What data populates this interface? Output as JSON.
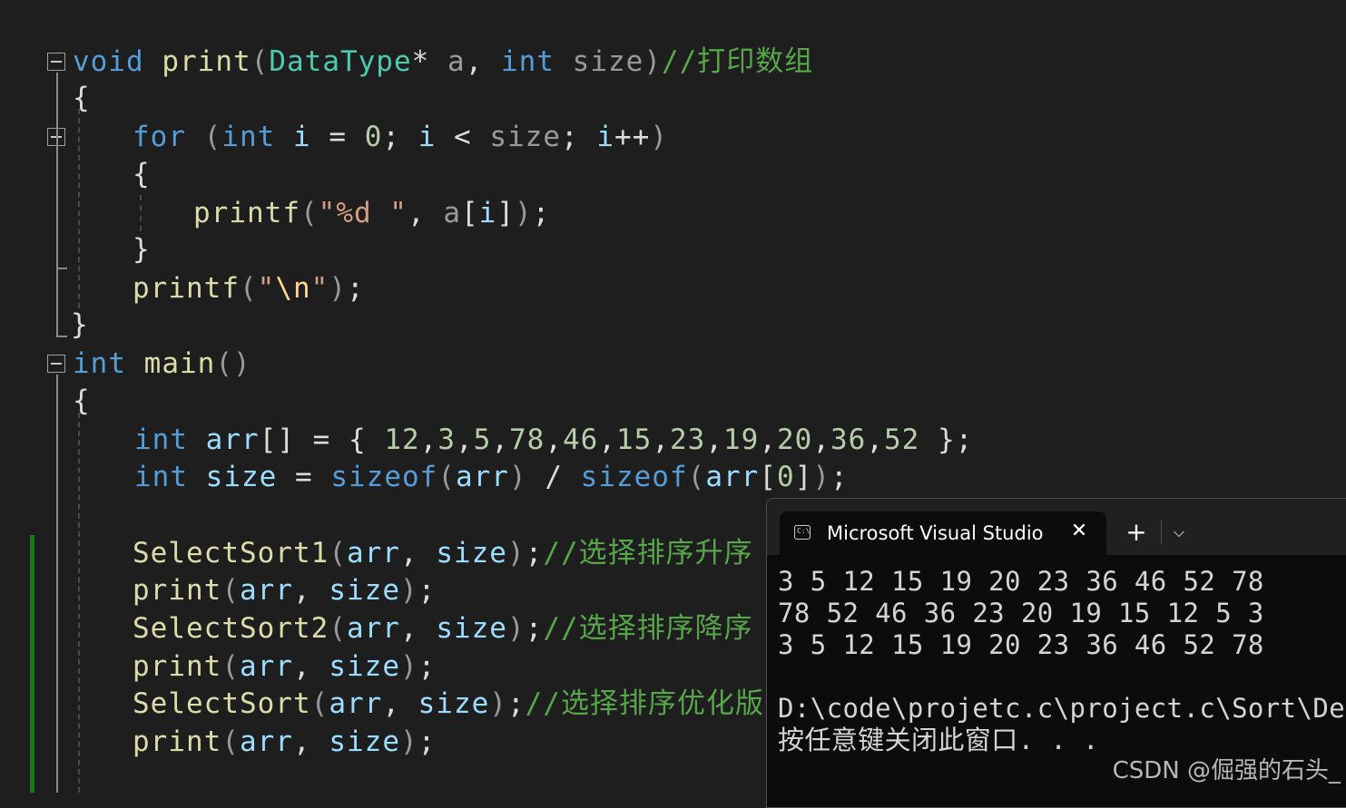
{
  "editor": {
    "lines": [
      {
        "tokens": [
          [
            "kw",
            "void"
          ],
          [
            "pl",
            " "
          ],
          [
            "fn",
            "print"
          ],
          [
            "pm",
            "("
          ],
          [
            "ty",
            "DataType"
          ],
          [
            "pl",
            "*"
          ],
          [
            "pl",
            " "
          ],
          [
            "pm",
            "a"
          ],
          [
            "pl",
            ", "
          ],
          [
            "kw",
            "int"
          ],
          [
            "pl",
            " "
          ],
          [
            "pm",
            "size"
          ],
          [
            "pm",
            ")"
          ],
          [
            "cm",
            "//打印数组"
          ]
        ]
      },
      {
        "tokens": [
          [
            "pl",
            "{"
          ]
        ]
      },
      {
        "tokens": [
          [
            "kw",
            "for"
          ],
          [
            "pl",
            " "
          ],
          [
            "pm",
            "("
          ],
          [
            "kw",
            "int"
          ],
          [
            "pl",
            " "
          ],
          [
            "vr",
            "i"
          ],
          [
            "pl",
            " = "
          ],
          [
            "nm",
            "0"
          ],
          [
            "pl",
            "; "
          ],
          [
            "vr",
            "i"
          ],
          [
            "pl",
            " < "
          ],
          [
            "pm",
            "size"
          ],
          [
            "pl",
            "; "
          ],
          [
            "vr",
            "i"
          ],
          [
            "pl",
            "++"
          ],
          [
            "pm",
            ")"
          ]
        ]
      },
      {
        "tokens": [
          [
            "pl",
            "{"
          ]
        ]
      },
      {
        "tokens": [
          [
            "fn",
            "printf"
          ],
          [
            "pm",
            "("
          ],
          [
            "st",
            "\"%d \""
          ],
          [
            "pl",
            ", "
          ],
          [
            "pm",
            "a"
          ],
          [
            "pl",
            "["
          ],
          [
            "vr",
            "i"
          ],
          [
            "pl",
            "]"
          ],
          [
            "pm",
            ")"
          ],
          [
            "pl",
            ";"
          ]
        ]
      },
      {
        "tokens": [
          [
            "pl",
            "}"
          ]
        ]
      },
      {
        "tokens": [
          [
            "fn",
            "printf"
          ],
          [
            "pm",
            "("
          ],
          [
            "st",
            "\""
          ],
          [
            "es",
            "\\n"
          ],
          [
            "st",
            "\""
          ],
          [
            "pm",
            ")"
          ],
          [
            "pl",
            ";"
          ]
        ]
      },
      {
        "tokens": [
          [
            "pl",
            "}"
          ]
        ]
      },
      {
        "tokens": [
          [
            "kw",
            "int"
          ],
          [
            "pl",
            " "
          ],
          [
            "fn",
            "main"
          ],
          [
            "pm",
            "()"
          ]
        ]
      },
      {
        "tokens": [
          [
            "pl",
            "{"
          ]
        ]
      },
      {
        "tokens": [
          [
            "kw",
            "int"
          ],
          [
            "pl",
            " "
          ],
          [
            "vr",
            "arr"
          ],
          [
            "pl",
            "[] = { "
          ],
          [
            "nm",
            "12"
          ],
          [
            "pl",
            ","
          ],
          [
            "nm",
            "3"
          ],
          [
            "pl",
            ","
          ],
          [
            "nm",
            "5"
          ],
          [
            "pl",
            ","
          ],
          [
            "nm",
            "78"
          ],
          [
            "pl",
            ","
          ],
          [
            "nm",
            "46"
          ],
          [
            "pl",
            ","
          ],
          [
            "nm",
            "15"
          ],
          [
            "pl",
            ","
          ],
          [
            "nm",
            "23"
          ],
          [
            "pl",
            ","
          ],
          [
            "nm",
            "19"
          ],
          [
            "pl",
            ","
          ],
          [
            "nm",
            "20"
          ],
          [
            "pl",
            ","
          ],
          [
            "nm",
            "36"
          ],
          [
            "pl",
            ","
          ],
          [
            "nm",
            "52"
          ],
          [
            "pl",
            " };"
          ]
        ]
      },
      {
        "tokens": [
          [
            "kw",
            "int"
          ],
          [
            "pl",
            " "
          ],
          [
            "vr",
            "size"
          ],
          [
            "pl",
            " = "
          ],
          [
            "kw",
            "sizeof"
          ],
          [
            "pm",
            "("
          ],
          [
            "vr",
            "arr"
          ],
          [
            "pm",
            ")"
          ],
          [
            "pl",
            " / "
          ],
          [
            "kw",
            "sizeof"
          ],
          [
            "pm",
            "("
          ],
          [
            "vr",
            "arr"
          ],
          [
            "pl",
            "["
          ],
          [
            "nm",
            "0"
          ],
          [
            "pl",
            "]"
          ],
          [
            "pm",
            ")"
          ],
          [
            "pl",
            ";"
          ]
        ]
      },
      {
        "tokens": [
          [
            "fn",
            "SelectSort1"
          ],
          [
            "pm",
            "("
          ],
          [
            "vr",
            "arr"
          ],
          [
            "pl",
            ", "
          ],
          [
            "vr",
            "size"
          ],
          [
            "pm",
            ")"
          ],
          [
            "pl",
            ";"
          ],
          [
            "cm",
            "//选择排序升序"
          ]
        ]
      },
      {
        "tokens": [
          [
            "fn",
            "print"
          ],
          [
            "pm",
            "("
          ],
          [
            "vr",
            "arr"
          ],
          [
            "pl",
            ", "
          ],
          [
            "vr",
            "size"
          ],
          [
            "pm",
            ")"
          ],
          [
            "pl",
            ";"
          ]
        ]
      },
      {
        "tokens": [
          [
            "fn",
            "SelectSort2"
          ],
          [
            "pm",
            "("
          ],
          [
            "vr",
            "arr"
          ],
          [
            "pl",
            ", "
          ],
          [
            "vr",
            "size"
          ],
          [
            "pm",
            ")"
          ],
          [
            "pl",
            ";"
          ],
          [
            "cm",
            "//选择排序降序"
          ]
        ]
      },
      {
        "tokens": [
          [
            "fn",
            "print"
          ],
          [
            "pm",
            "("
          ],
          [
            "vr",
            "arr"
          ],
          [
            "pl",
            ", "
          ],
          [
            "vr",
            "size"
          ],
          [
            "pm",
            ")"
          ],
          [
            "pl",
            ";"
          ]
        ]
      },
      {
        "tokens": [
          [
            "fn",
            "SelectSort"
          ],
          [
            "pm",
            "("
          ],
          [
            "vr",
            "arr"
          ],
          [
            "pl",
            ", "
          ],
          [
            "vr",
            "size"
          ],
          [
            "pm",
            ")"
          ],
          [
            "pl",
            ";"
          ],
          [
            "cm",
            "//选择排序优化版"
          ]
        ]
      },
      {
        "tokens": [
          [
            "fn",
            "print"
          ],
          [
            "pm",
            "("
          ],
          [
            "vr",
            "arr"
          ],
          [
            "pl",
            ", "
          ],
          [
            "vr",
            "size"
          ],
          [
            "pm",
            ")"
          ],
          [
            "pl",
            ";"
          ]
        ]
      }
    ]
  },
  "console": {
    "tab_title": "Microsoft Visual Studio",
    "tab_icon": "terminal-icon",
    "close_glyph": "✕",
    "new_tab_glyph": "+",
    "dropdown_glyph": "⌵",
    "output": [
      "3 5 12 15 19 20 23 36 46 52 78",
      "78 52 46 36 23 20 19 15 12 5 3",
      "3 5 12 15 19 20 23 36 46 52 78",
      "",
      "D:\\code\\projetc.c\\project.c\\Sort\\De",
      "按任意键关闭此窗口. . ."
    ]
  },
  "watermark": "CSDN @倔强的石头_",
  "colors": {
    "keyword": "#569cd6",
    "function": "#dcdcaa",
    "type": "#4ec9b0",
    "comment": "#57a64a",
    "number": "#b5cea8",
    "string": "#d69d85",
    "variable": "#9cdcfe",
    "background": "#1e1e1e"
  }
}
